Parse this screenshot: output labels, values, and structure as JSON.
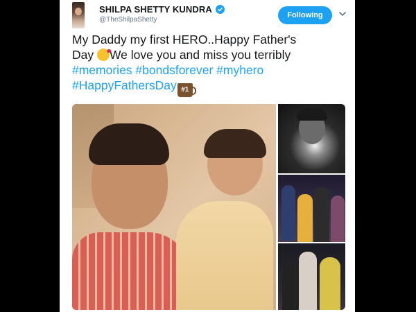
{
  "tweet": {
    "author": {
      "display_name": "SHILPA SHETTY KUNDRA",
      "handle": "@TheShilpaShetty",
      "verified": true
    },
    "follow_button": {
      "label": "Following"
    },
    "text": {
      "line1": "My Daddy my first HERO..Happy Father's",
      "line2_text": "We love you and miss you terribly",
      "line2_prefix": "Day ",
      "line3_hashtags": "#memories #bondsforever #myhero",
      "line4_hashtag": "#HappyFathersDay",
      "badge_label": "#1"
    },
    "icons": {
      "kiss_emoji": "face-blowing-kiss-icon",
      "mug_emoji": "number-one-mug-icon",
      "verified": "verified-badge-icon",
      "menu": "chevron-down-icon"
    },
    "colors": {
      "accent": "#1da1f2",
      "text": "#14171a",
      "secondary_text": "#657786",
      "background": "#000000"
    }
  }
}
